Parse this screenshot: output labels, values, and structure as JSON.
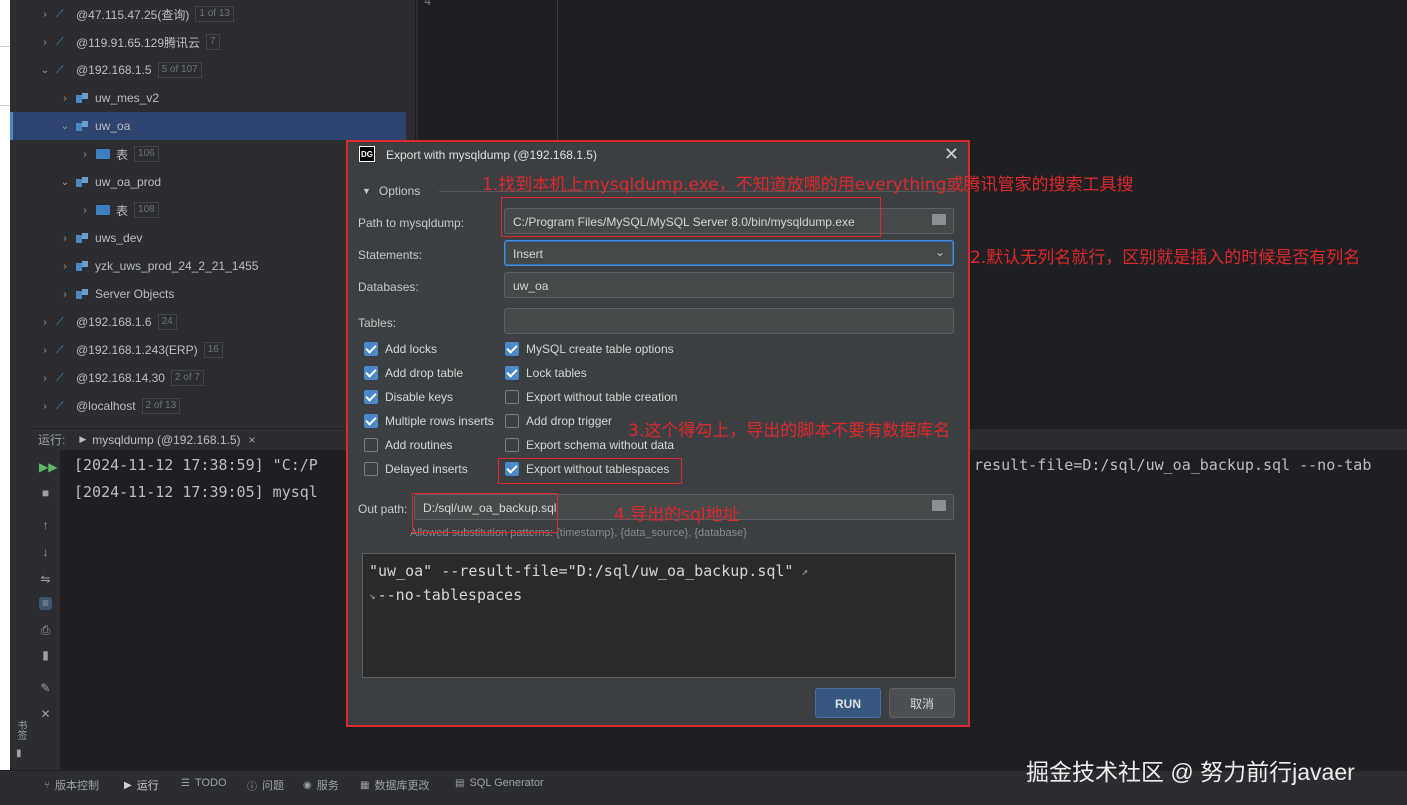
{
  "db_tree": {
    "rows": [
      {
        "label": "@47.115.47.25(查询)",
        "badge": "1 of 13",
        "indent": 0,
        "kind": "host",
        "expanded": false
      },
      {
        "label": "@119.91.65.129腾讯云",
        "badge": "7",
        "indent": 0,
        "kind": "host",
        "expanded": false
      },
      {
        "label": "@192.168.1.5",
        "badge": "5 of 107",
        "indent": 0,
        "kind": "host",
        "expanded": true
      },
      {
        "label": "uw_mes_v2",
        "badge": "",
        "indent": 1,
        "kind": "schema",
        "expanded": false
      },
      {
        "label": "uw_oa",
        "badge": "",
        "indent": 1,
        "kind": "schema",
        "expanded": true,
        "selected": true
      },
      {
        "label": "表",
        "badge": "106",
        "indent": 2,
        "kind": "folder",
        "expanded": false
      },
      {
        "label": "uw_oa_prod",
        "badge": "",
        "indent": 1,
        "kind": "schema",
        "expanded": true
      },
      {
        "label": "表",
        "badge": "108",
        "indent": 2,
        "kind": "folder",
        "expanded": false
      },
      {
        "label": "uws_dev",
        "badge": "",
        "indent": 1,
        "kind": "schema",
        "expanded": false
      },
      {
        "label": "yzk_uws_prod_24_2_21_1455",
        "badge": "",
        "indent": 1,
        "kind": "schema",
        "expanded": false
      },
      {
        "label": "Server Objects",
        "badge": "",
        "indent": 1,
        "kind": "schema",
        "expanded": false
      },
      {
        "label": "@192.168.1.6",
        "badge": "24",
        "indent": 0,
        "kind": "host",
        "expanded": false
      },
      {
        "label": "@192.168.1.243(ERP)",
        "badge": "16",
        "indent": 0,
        "kind": "host",
        "expanded": false
      },
      {
        "label": "@192.168.14.30",
        "badge": "2 of 7",
        "indent": 0,
        "kind": "host",
        "expanded": false
      },
      {
        "label": "@localhost",
        "badge": "2 of 13",
        "indent": 0,
        "kind": "host",
        "expanded": false
      }
    ]
  },
  "run_panel": {
    "tab_label": "运行:",
    "run_tab": "mysqldump (@192.168.1.5)",
    "lines": [
      "[2024-11-12 17:38:59] \"C:/P",
      "[2024-11-12 17:39:05] mysql"
    ],
    "right_text": "result-file=D:/sql/uw_oa_backup.sql --no-tab"
  },
  "dialog": {
    "title": "Export with mysqldump (@192.168.1.5)",
    "logo": "DG",
    "options_label": "Options",
    "path_label": "Path to mysqldump:",
    "path_value": "C:/Program Files/MySQL/MySQL Server 8.0/bin/mysqldump.exe",
    "statements_label": "Statements:",
    "statements_value": "Insert",
    "databases_label": "Databases:",
    "databases_value": "uw_oa",
    "tables_label": "Tables:",
    "tables_value": "",
    "checkboxes_left": [
      {
        "label": "Add locks",
        "checked": true
      },
      {
        "label": "Add drop table",
        "checked": true
      },
      {
        "label": "Disable keys",
        "checked": true
      },
      {
        "label": "Multiple rows inserts",
        "checked": true
      },
      {
        "label": "Add routines",
        "checked": false
      },
      {
        "label": "Delayed inserts",
        "checked": false
      }
    ],
    "checkboxes_right": [
      {
        "label": "MySQL create table options",
        "checked": true
      },
      {
        "label": "Lock tables",
        "checked": true
      },
      {
        "label": "Export without table creation",
        "checked": false
      },
      {
        "label": "Add drop trigger",
        "checked": false
      },
      {
        "label": "Export schema without data",
        "checked": false
      },
      {
        "label": "Export without tablespaces",
        "checked": true
      }
    ],
    "out_path_label": "Out path:",
    "out_path_value": "D:/sql/uw_oa_backup.sql",
    "hint": "Allowed substitution patterns: {timestamp}, {data_source}, {database}",
    "cmd_line1": "\"uw_oa\" --result-file=\"D:/sql/uw_oa_backup.sql\"",
    "cmd_line2": "--no-tablespaces",
    "run_label": "RUN",
    "cancel_label": "取消"
  },
  "annotations": {
    "a1": "1.找到本机上mysqldump.exe，不知道放哪的用everything或腾讯管家的搜索工具搜",
    "a2": "2.默认无列名就行，区别就是插入的时候是否有列名",
    "a3": "3.这个得勾上，导出的脚本不要有数据库名",
    "a4": "4.导出的sql地址"
  },
  "status_bar": {
    "items": [
      "版本控制",
      "运行",
      "TODO",
      "问题",
      "服务",
      "数据库更改",
      "SQL Generator"
    ]
  },
  "side_label": "书签",
  "watermark": "掘金技术社区 @ 努力前行javaer",
  "colors": {
    "annotation": "#e0282b",
    "checkbox_on": "#4a88c7",
    "run_button": "#365880"
  }
}
